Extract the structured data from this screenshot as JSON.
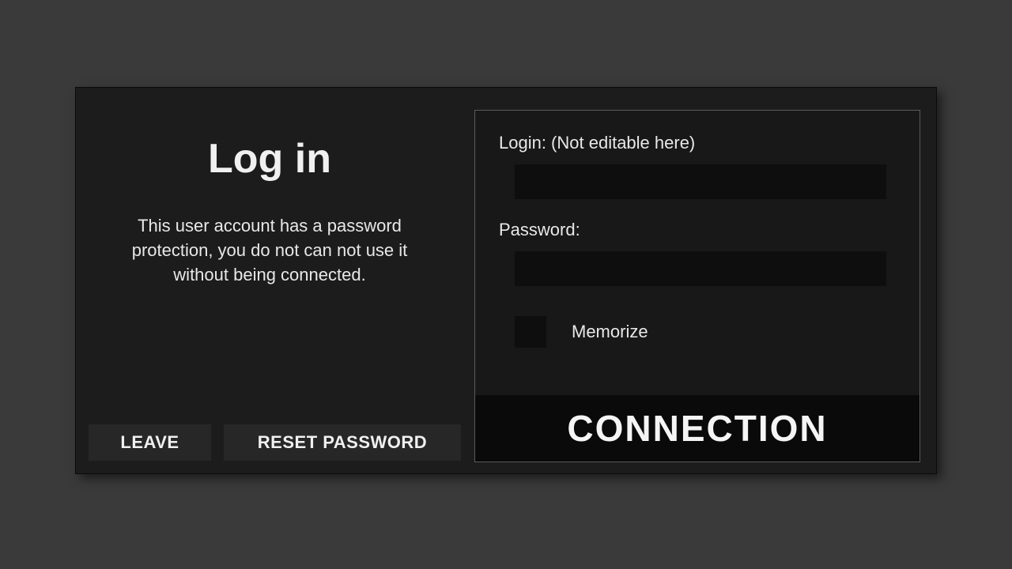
{
  "left": {
    "title": "Log in",
    "description": "This user account has a password protection, you do not can not use it without being connected.",
    "leave_label": "LEAVE",
    "reset_label": "RESET PASSWORD"
  },
  "form": {
    "login_label": "Login: (Not editable here)",
    "login_value": "",
    "password_label": "Password:",
    "password_value": "",
    "memorize_label": "Memorize",
    "submit_label": "CONNECTION"
  }
}
